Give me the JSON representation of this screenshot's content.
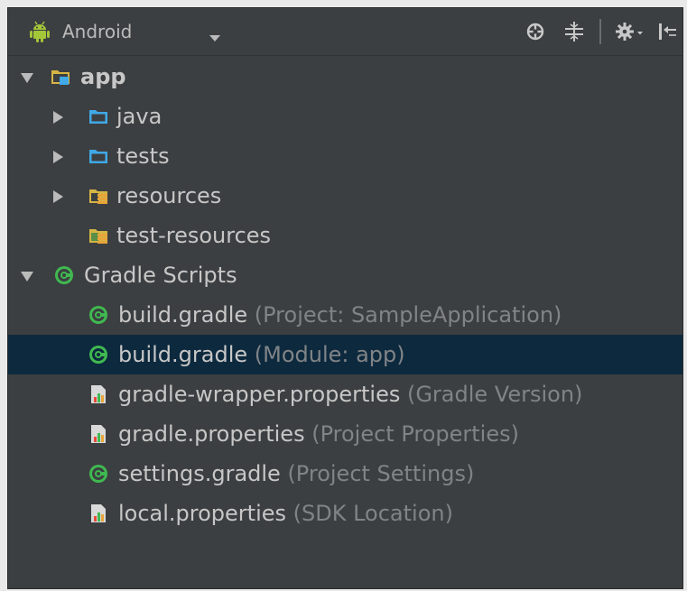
{
  "toolbar": {
    "view_label": "Android",
    "icons": [
      "android-icon",
      "dropdown-caret-icon",
      "scroll-from-source-icon",
      "collapse-all-icon",
      "settings-icon",
      "hide-panel-icon"
    ]
  },
  "tree": [
    {
      "label": "app",
      "hint": "",
      "icon": "module-folder-icon",
      "expanded": true
    },
    {
      "label": "java",
      "hint": "",
      "icon": "source-folder-icon",
      "expanded": false
    },
    {
      "label": "tests",
      "hint": "",
      "icon": "test-folder-icon",
      "expanded": false
    },
    {
      "label": "resources",
      "hint": "",
      "icon": "resource-folder-icon",
      "expanded": false
    },
    {
      "label": "test-resources",
      "hint": "",
      "icon": "test-resource-folder-icon",
      "expanded": null
    },
    {
      "label": "Gradle Scripts",
      "hint": "",
      "icon": "gradle-icon",
      "expanded": true
    },
    {
      "label": "build.gradle",
      "hint": " (Project: SampleApplication)",
      "icon": "gradle-file-icon"
    },
    {
      "label": "build.gradle",
      "hint": " (Module: app)",
      "icon": "gradle-file-icon",
      "selected": true
    },
    {
      "label": "gradle-wrapper.properties",
      "hint": " (Gradle Version)",
      "icon": "properties-file-icon"
    },
    {
      "label": "gradle.properties",
      "hint": " (Project Properties)",
      "icon": "properties-file-icon"
    },
    {
      "label": "settings.gradle",
      "hint": " (Project Settings)",
      "icon": "gradle-file-icon"
    },
    {
      "label": "local.properties",
      "hint": " (SDK Location)",
      "icon": "properties-file-icon"
    }
  ],
  "colors": {
    "panel_bg": "#3c3f41",
    "selection_bg": "#0d293e",
    "text": "#c7c7c7",
    "hint_text": "#808487",
    "android_green": "#a4c639",
    "gradle_green": "#3fb950",
    "folder_blue": "#40a9e8",
    "folder_yellow": "#d6b545"
  }
}
